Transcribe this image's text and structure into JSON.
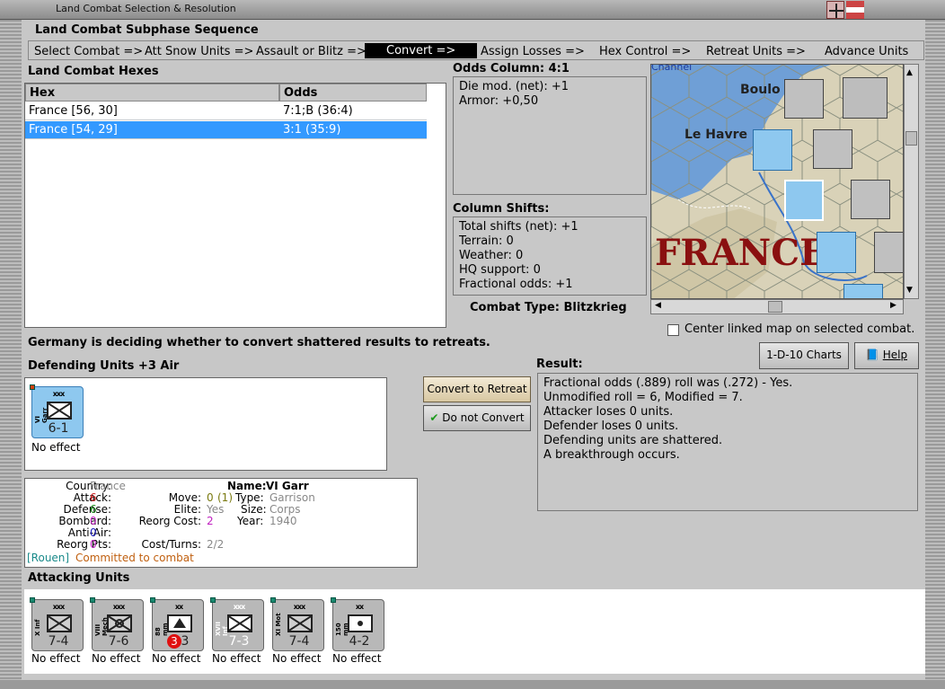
{
  "window": {
    "title": "Land Combat Selection & Resolution"
  },
  "sequence": {
    "title": "Land Combat Subphase Sequence",
    "items": [
      {
        "label": "Select Combat =>",
        "active": false
      },
      {
        "label": "Att Snow Units =>",
        "active": false
      },
      {
        "label": "Assault or Blitz =>",
        "active": false
      },
      {
        "label": "Convert =>",
        "active": true
      },
      {
        "label": "Assign Losses =>",
        "active": false
      },
      {
        "label": "Hex Control =>",
        "active": false
      },
      {
        "label": "Retreat Units =>",
        "active": false
      },
      {
        "label": "Advance Units",
        "active": false
      }
    ]
  },
  "hexes": {
    "title": "Land Combat Hexes",
    "columns": [
      "Hex",
      "Odds"
    ],
    "rows": [
      {
        "hex": "France [56, 30]",
        "odds": "7:1;B (36:4)",
        "selected": false
      },
      {
        "hex": "France [54, 29]",
        "odds": "3:1 (35:9)",
        "selected": true
      }
    ]
  },
  "odds": {
    "title": "Odds Column: 4:1",
    "lines": [
      "Die mod. (net): +1",
      "Armor: +0,50"
    ]
  },
  "shifts": {
    "title": "Column Shifts:",
    "lines": [
      "Total shifts (net): +1",
      "Terrain: 0",
      "Weather: 0",
      "HQ support: 0",
      "Fractional odds: +1"
    ]
  },
  "combat_type": "Combat Type:  Blitzkrieg",
  "map": {
    "labels": {
      "boulogne": "Boulo",
      "le_havre": "Le Havre",
      "france": "FRANCE",
      "channel": "Channel"
    }
  },
  "center_map": {
    "label": "Center linked map on selected combat.",
    "checked": false
  },
  "status_message": "Germany is deciding whether to convert shattered results to retreats.",
  "buttons": {
    "charts": "1-D-10 Charts",
    "help": "Help",
    "convert": "Convert to Retreat",
    "no_convert": "Do not Convert"
  },
  "defending": {
    "title": "Defending Units +3 Air",
    "units": [
      {
        "name": "VI Garr",
        "size": "xxx",
        "strength": "6-1",
        "effect": "No effect",
        "color": "blue"
      }
    ]
  },
  "result": {
    "title": "Result:",
    "lines": [
      "Fractional odds (.889) roll was (.272)  - Yes.",
      "Unmodified roll = 6, Modified = 7.",
      "Attacker loses 0 units.",
      "Defender loses 0 units.",
      "Defending units are shattered.",
      "A breakthrough occurs."
    ]
  },
  "details": {
    "country_label": "Country:",
    "country": "France",
    "attack_label": "Attack:",
    "attack": "6",
    "defense_label": "Defense:",
    "defense": "6",
    "bombard_label": "Bombard:",
    "bombard": "0",
    "antiair_label": "Anti-Air:",
    "antiair": "0",
    "reorg_pts_label": "Reorg Pts:",
    "reorg_pts": "0",
    "name_label": "Name:",
    "name": "VI Garr",
    "move_label": "Move:",
    "move": "0",
    "move_paren": "(1)",
    "type_label": "Type:",
    "type": "Garrison",
    "elite_label": "Elite:",
    "elite": "Yes",
    "size_label": "Size:",
    "size": "Corps",
    "reorg_cost_label": "Reorg Cost:",
    "reorg_cost": "2",
    "year_label": "Year:",
    "year": "1940",
    "cost_turns_label": "Cost/Turns:",
    "cost_turns": "2/2",
    "location": "[Rouen]",
    "status": "Committed to combat"
  },
  "attacking": {
    "title": "Attacking Units",
    "units": [
      {
        "name": "X Inf",
        "size": "xxx",
        "strength": "7-4",
        "effect": "No effect",
        "symbol": "x"
      },
      {
        "name": "VIII Mech",
        "size": "xxx",
        "strength": "7-6",
        "effect": "No effect",
        "symbol": "x"
      },
      {
        "name": "88 mm",
        "size": "xx",
        "strength": "3",
        "badge": "3",
        "effect": "No effect",
        "symbol": "tri"
      },
      {
        "name": "XVII Inf",
        "size": "xxx",
        "strength": "7-3",
        "effect": "No effect",
        "symbol": "x"
      },
      {
        "name": "XI Mot",
        "size": "xxx",
        "strength": "7-4",
        "effect": "No effect",
        "symbol": "x"
      },
      {
        "name": "150 mm",
        "size": "xx",
        "strength": "4-2",
        "effect": "No effect",
        "symbol": "dot"
      }
    ]
  }
}
